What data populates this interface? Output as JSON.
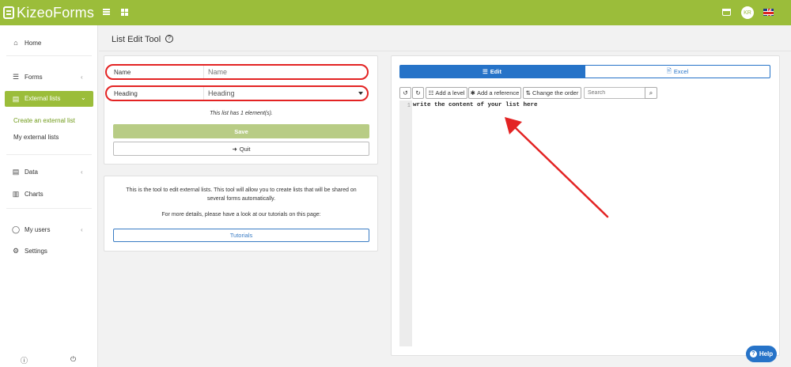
{
  "app": {
    "logo_prefix": "Kizeo",
    "logo_suffix": "Forms",
    "user_initials": "KR"
  },
  "sidebar": {
    "items": [
      {
        "label": "Home",
        "icon": "home-icon"
      },
      {
        "label": "Forms",
        "icon": "forms-icon"
      },
      {
        "label": "External lists",
        "icon": "list-icon",
        "active": true
      },
      {
        "label": "Data",
        "icon": "data-icon"
      },
      {
        "label": "Charts",
        "icon": "chart-icon"
      },
      {
        "label": "My users",
        "icon": "user-icon"
      },
      {
        "label": "Settings",
        "icon": "gear-icon"
      }
    ],
    "sub_items": [
      {
        "label": "Create an external list",
        "active": true
      },
      {
        "label": "My external lists"
      }
    ]
  },
  "page": {
    "title": "List Edit Tool",
    "help_glyph": "?"
  },
  "form": {
    "name_label": "Name",
    "name_placeholder": "Name",
    "heading_label": "Heading",
    "heading_value": "Heading",
    "count_text": "This list has 1 element(s).",
    "save_label": "Save",
    "quit_label": "Quit"
  },
  "info": {
    "line1": "This is the tool to edit external lists. This tool will allow you to create lists that will be shared on",
    "line2": "several forms automatically.",
    "line3": "For more details, please have a look at our tutorials on this page:",
    "tutorials_label": "Tutorials"
  },
  "editor": {
    "tab_edit": "Edit",
    "tab_excel": "Excel",
    "add_level": "Add a level",
    "add_reference": "Add a reference",
    "change_order": "Change the order",
    "search_placeholder": "Search",
    "line_number": "1",
    "content": "write the content of your list here"
  },
  "help_button": "Help",
  "colors": {
    "brand": "#9bbd3a",
    "primary": "#2673c8",
    "annotation": "#e32323"
  }
}
